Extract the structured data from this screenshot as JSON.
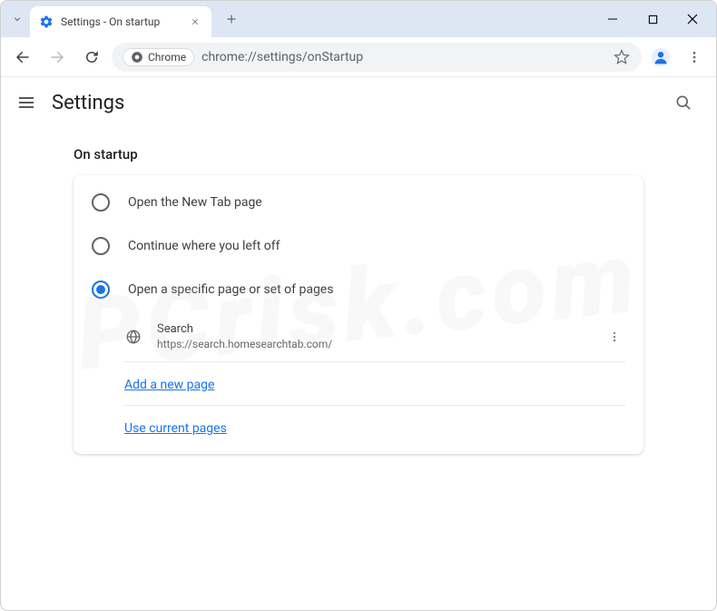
{
  "window": {
    "tab_title": "Settings - On startup"
  },
  "toolbar": {
    "chrome_chip": "Chrome",
    "url": "chrome://settings/onStartup"
  },
  "header": {
    "title": "Settings"
  },
  "section": {
    "title": "On startup"
  },
  "options": [
    {
      "label": "Open the New Tab page",
      "selected": false
    },
    {
      "label": "Continue where you left off",
      "selected": false
    },
    {
      "label": "Open a specific page or set of pages",
      "selected": true
    }
  ],
  "pages": [
    {
      "name": "Search",
      "url": "https://search.homesearchtab.com/"
    }
  ],
  "links": {
    "add_page": "Add a new page",
    "use_current": "Use current pages"
  },
  "watermark": "PCrisk.com"
}
